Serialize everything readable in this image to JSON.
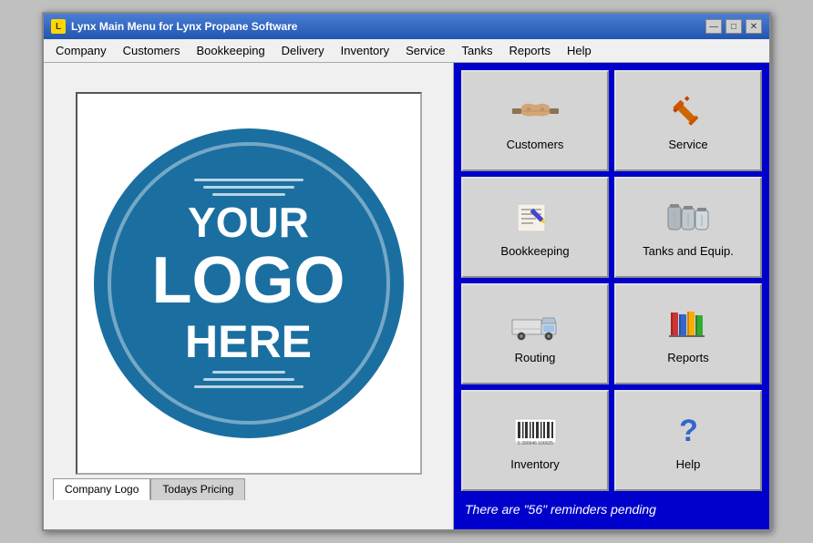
{
  "window": {
    "title": "Lynx Main Menu for Lynx Propane Software",
    "icon": "L"
  },
  "titleControls": {
    "minimize": "—",
    "maximize": "□",
    "close": "✕"
  },
  "menuBar": {
    "items": [
      {
        "label": "Company",
        "id": "company"
      },
      {
        "label": "Customers",
        "id": "customers"
      },
      {
        "label": "Bookkeeping",
        "id": "bookkeeping"
      },
      {
        "label": "Delivery",
        "id": "delivery"
      },
      {
        "label": "Inventory",
        "id": "inventory"
      },
      {
        "label": "Service",
        "id": "service"
      },
      {
        "label": "Tanks",
        "id": "tanks"
      },
      {
        "label": "Reports",
        "id": "reports"
      },
      {
        "label": "Help",
        "id": "help"
      }
    ]
  },
  "logo": {
    "line1": "YOUR",
    "line2": "LOGO",
    "line3": "HERE"
  },
  "tabs": [
    {
      "label": "Company Logo",
      "active": true
    },
    {
      "label": "Todays Pricing",
      "active": false
    }
  ],
  "buttons": [
    {
      "id": "customers",
      "label": "Customers",
      "icon": "handshake"
    },
    {
      "id": "service",
      "label": "Service",
      "icon": "wrench"
    },
    {
      "id": "bookkeeping",
      "label": "Bookkeeping",
      "icon": "pencil"
    },
    {
      "id": "tanks",
      "label": "Tanks and Equip.",
      "icon": "tanks"
    },
    {
      "id": "routing",
      "label": "Routing",
      "icon": "truck"
    },
    {
      "id": "reports",
      "label": "Reports",
      "icon": "books"
    },
    {
      "id": "inventory",
      "label": "Inventory",
      "icon": "barcode"
    },
    {
      "id": "help",
      "label": "Help",
      "icon": "question"
    }
  ],
  "reminders": {
    "text": "There are \"56\" reminders pending"
  }
}
